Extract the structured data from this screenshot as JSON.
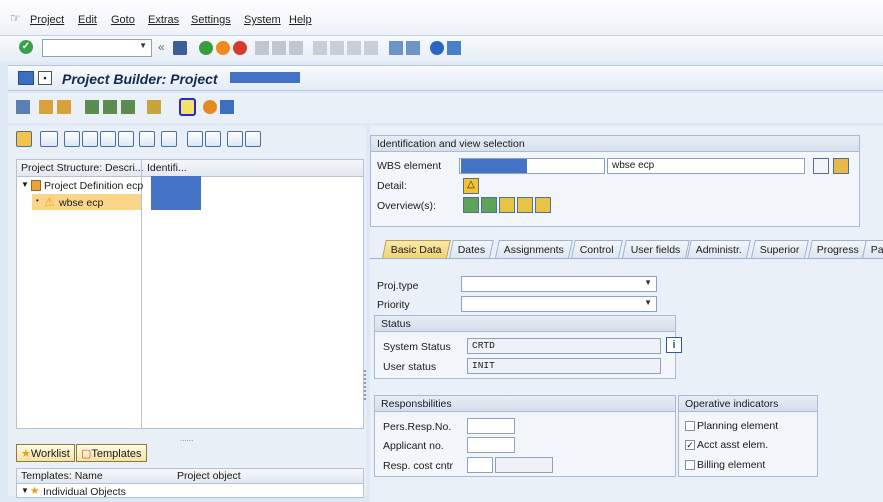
{
  "menubar": {
    "items": [
      "Project",
      "Edit",
      "Goto",
      "Extras",
      "Settings",
      "System",
      "Help"
    ]
  },
  "header": {
    "title": "Project Builder: Project"
  },
  "left": {
    "tree_col1": "Project Structure: Descri...",
    "tree_col2": "Identifi...",
    "node_root": "Project Definition ecp",
    "node_child": "wbse ecp",
    "worklist_tab": "Worklist",
    "templates_tab": "Templates",
    "dots": "......",
    "tpl_col1": "Templates: Name",
    "tpl_col2": "Project object",
    "tpl_item": "Individual Objects"
  },
  "ident": {
    "header": "Identification and view selection",
    "wbs_label": "WBS element",
    "wbs_desc": "wbse ecp",
    "detail_label": "Detail:",
    "overview_label": "Overview(s):"
  },
  "tabs": [
    "Basic Data",
    "Dates",
    "Assignments",
    "Control",
    "User fields",
    "Administr.",
    "Superior",
    "Progress",
    "Pa"
  ],
  "basic": {
    "projtype_label": "Proj.type",
    "priority_label": "Priority",
    "status_header": "Status",
    "system_status_label": "System Status",
    "system_status_value": "CRTD",
    "user_status_label": "User status",
    "user_status_value": "INIT",
    "resp_header": "Responsbilities",
    "pers_resp_label": "Pers.Resp.No.",
    "applicant_label": "Applicant no.",
    "cost_cntr_label": "Resp. cost cntr",
    "op_header": "Operative indicators",
    "planning_label": "Planning element",
    "acct_label": "Acct asst elem.",
    "billing_label": "Billing element"
  },
  "checks": {
    "planning": false,
    "acct": true,
    "billing": false
  },
  "colors": {
    "accent_tab": "#f2d275",
    "redaction": "#4472c4",
    "warning": "#f4b400"
  }
}
